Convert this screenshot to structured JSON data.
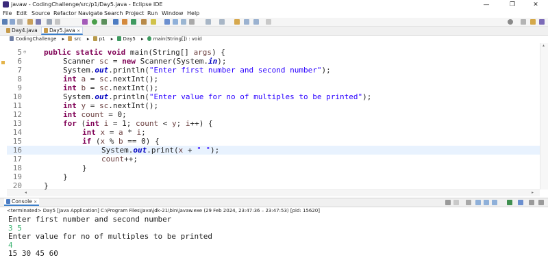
{
  "window": {
    "title": "javaw - CodingChallenge/src/p1/Day5.java - Eclipse IDE",
    "controls": [
      "—",
      "❐",
      "✕"
    ]
  },
  "menu": [
    "File",
    "Edit",
    "Source",
    "Refactor",
    "Navigate",
    "Search",
    "Project",
    "Run",
    "Window",
    "Help"
  ],
  "editor_tabs": [
    {
      "label": "Day4.java",
      "active": false
    },
    {
      "label": "Day5.java",
      "active": true,
      "close": "✕"
    }
  ],
  "breadcrumb": [
    "CodingChallenge",
    "src",
    "p1",
    "Day5",
    "main(String[]) : void"
  ],
  "code_lines": [
    {
      "n": "5",
      "html": "<span class=\"kw\">public static void</span> main(String[] <span class=\"var\">args</span>) {",
      "indent": 1,
      "marker": "⊖"
    },
    {
      "n": "6",
      "html": "Scanner <span class=\"var\">sc</span> = <span class=\"kw\">new</span> Scanner(System.<span class=\"fld\">in</span>);",
      "indent": 2
    },
    {
      "n": "7",
      "html": "System.<span class=\"fld\">out</span>.println(<span class=\"str\">\"Enter first number and second number\"</span>);",
      "indent": 2
    },
    {
      "n": "8",
      "html": "<span class=\"kw\">int</span> <span class=\"var\">a</span> = <span class=\"var\">sc</span>.nextInt();",
      "indent": 2
    },
    {
      "n": "9",
      "html": "<span class=\"kw\">int</span> <span class=\"var\">b</span> = <span class=\"var\">sc</span>.nextInt();",
      "indent": 2
    },
    {
      "n": "10",
      "html": "System.<span class=\"fld\">out</span>.println(<span class=\"str\">\"Enter value for no of multiples to be printed\"</span>);",
      "indent": 2
    },
    {
      "n": "11",
      "html": "<span class=\"kw\">int</span> <span class=\"var\">y</span> = <span class=\"var\">sc</span>.nextInt();",
      "indent": 2
    },
    {
      "n": "12",
      "html": "<span class=\"kw\">int</span> <span class=\"var\">count</span> = 0;",
      "indent": 2
    },
    {
      "n": "13",
      "html": "<span class=\"kw\">for</span> (<span class=\"kw\">int</span> <span class=\"var\">i</span> = 1; <span class=\"var\">count</span> &lt; <span class=\"var\">y</span>; <span class=\"var\">i</span>++) {",
      "indent": 2
    },
    {
      "n": "14",
      "html": "<span class=\"kw\">int</span> <span class=\"var\">x</span> = <span class=\"var\">a</span> * <span class=\"var\">i</span>;",
      "indent": 3
    },
    {
      "n": "15",
      "html": "<span class=\"kw\">if</span> (<span class=\"var\">x</span> % <span class=\"var\">b</span> == 0) {",
      "indent": 3
    },
    {
      "n": "16",
      "html": "System.<span class=\"fld\">out</span>.print(<span class=\"var\">x</span> + <span class=\"str\">\" \"</span>);",
      "indent": 4,
      "current": true
    },
    {
      "n": "17",
      "html": "<span class=\"var\">count</span>++;",
      "indent": 4
    },
    {
      "n": "18",
      "html": "}",
      "indent": 3
    },
    {
      "n": "19",
      "html": "}",
      "indent": 2
    },
    {
      "n": "20",
      "html": "}",
      "indent": 1
    }
  ],
  "console": {
    "tab_label": "Console",
    "status": "<terminated> Day5 [Java Application] C:\\Program Files\\Java\\jdk-21\\bin\\javaw.exe  (29 Feb 2024, 23:47:36 – 23:47:53) [pid: 15620]",
    "lines": [
      {
        "text": "Enter first number and second number",
        "input": false
      },
      {
        "text": "3 5",
        "input": true
      },
      {
        "text": "Enter value for no of multiples to be printed",
        "input": false
      },
      {
        "text": "4",
        "input": true
      },
      {
        "text": "15 30 45 60",
        "input": false
      }
    ]
  }
}
